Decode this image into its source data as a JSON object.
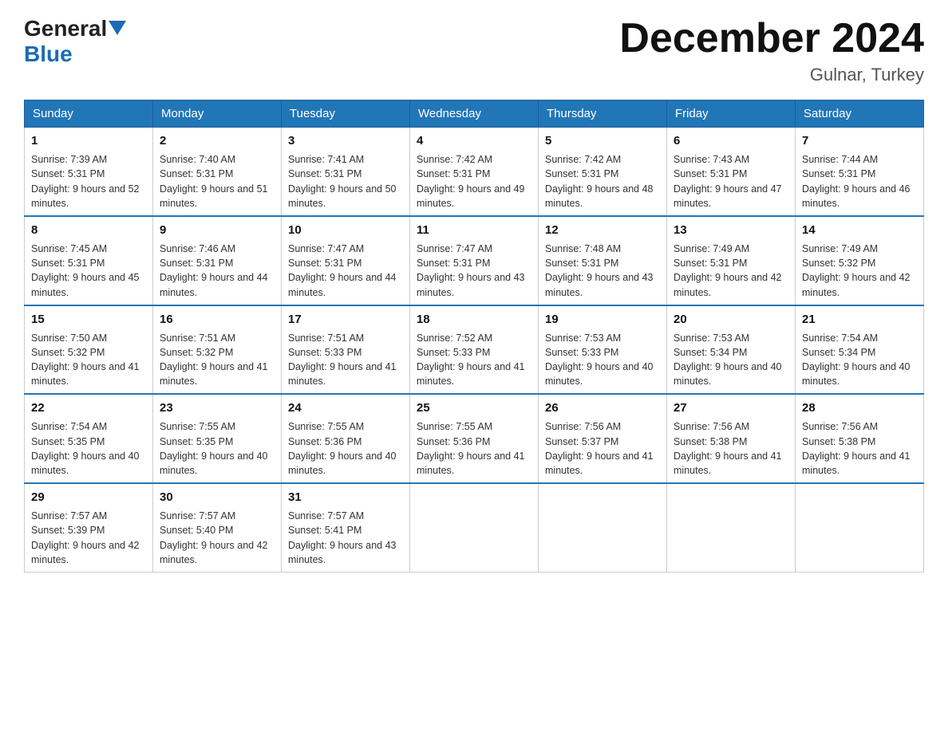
{
  "header": {
    "logo_general": "General",
    "logo_blue": "Blue",
    "month_title": "December 2024",
    "location": "Gulnar, Turkey"
  },
  "weekdays": [
    "Sunday",
    "Monday",
    "Tuesday",
    "Wednesday",
    "Thursday",
    "Friday",
    "Saturday"
  ],
  "weeks": [
    [
      {
        "day": "1",
        "sunrise": "Sunrise: 7:39 AM",
        "sunset": "Sunset: 5:31 PM",
        "daylight": "Daylight: 9 hours and 52 minutes."
      },
      {
        "day": "2",
        "sunrise": "Sunrise: 7:40 AM",
        "sunset": "Sunset: 5:31 PM",
        "daylight": "Daylight: 9 hours and 51 minutes."
      },
      {
        "day": "3",
        "sunrise": "Sunrise: 7:41 AM",
        "sunset": "Sunset: 5:31 PM",
        "daylight": "Daylight: 9 hours and 50 minutes."
      },
      {
        "day": "4",
        "sunrise": "Sunrise: 7:42 AM",
        "sunset": "Sunset: 5:31 PM",
        "daylight": "Daylight: 9 hours and 49 minutes."
      },
      {
        "day": "5",
        "sunrise": "Sunrise: 7:42 AM",
        "sunset": "Sunset: 5:31 PM",
        "daylight": "Daylight: 9 hours and 48 minutes."
      },
      {
        "day": "6",
        "sunrise": "Sunrise: 7:43 AM",
        "sunset": "Sunset: 5:31 PM",
        "daylight": "Daylight: 9 hours and 47 minutes."
      },
      {
        "day": "7",
        "sunrise": "Sunrise: 7:44 AM",
        "sunset": "Sunset: 5:31 PM",
        "daylight": "Daylight: 9 hours and 46 minutes."
      }
    ],
    [
      {
        "day": "8",
        "sunrise": "Sunrise: 7:45 AM",
        "sunset": "Sunset: 5:31 PM",
        "daylight": "Daylight: 9 hours and 45 minutes."
      },
      {
        "day": "9",
        "sunrise": "Sunrise: 7:46 AM",
        "sunset": "Sunset: 5:31 PM",
        "daylight": "Daylight: 9 hours and 44 minutes."
      },
      {
        "day": "10",
        "sunrise": "Sunrise: 7:47 AM",
        "sunset": "Sunset: 5:31 PM",
        "daylight": "Daylight: 9 hours and 44 minutes."
      },
      {
        "day": "11",
        "sunrise": "Sunrise: 7:47 AM",
        "sunset": "Sunset: 5:31 PM",
        "daylight": "Daylight: 9 hours and 43 minutes."
      },
      {
        "day": "12",
        "sunrise": "Sunrise: 7:48 AM",
        "sunset": "Sunset: 5:31 PM",
        "daylight": "Daylight: 9 hours and 43 minutes."
      },
      {
        "day": "13",
        "sunrise": "Sunrise: 7:49 AM",
        "sunset": "Sunset: 5:31 PM",
        "daylight": "Daylight: 9 hours and 42 minutes."
      },
      {
        "day": "14",
        "sunrise": "Sunrise: 7:49 AM",
        "sunset": "Sunset: 5:32 PM",
        "daylight": "Daylight: 9 hours and 42 minutes."
      }
    ],
    [
      {
        "day": "15",
        "sunrise": "Sunrise: 7:50 AM",
        "sunset": "Sunset: 5:32 PM",
        "daylight": "Daylight: 9 hours and 41 minutes."
      },
      {
        "day": "16",
        "sunrise": "Sunrise: 7:51 AM",
        "sunset": "Sunset: 5:32 PM",
        "daylight": "Daylight: 9 hours and 41 minutes."
      },
      {
        "day": "17",
        "sunrise": "Sunrise: 7:51 AM",
        "sunset": "Sunset: 5:33 PM",
        "daylight": "Daylight: 9 hours and 41 minutes."
      },
      {
        "day": "18",
        "sunrise": "Sunrise: 7:52 AM",
        "sunset": "Sunset: 5:33 PM",
        "daylight": "Daylight: 9 hours and 41 minutes."
      },
      {
        "day": "19",
        "sunrise": "Sunrise: 7:53 AM",
        "sunset": "Sunset: 5:33 PM",
        "daylight": "Daylight: 9 hours and 40 minutes."
      },
      {
        "day": "20",
        "sunrise": "Sunrise: 7:53 AM",
        "sunset": "Sunset: 5:34 PM",
        "daylight": "Daylight: 9 hours and 40 minutes."
      },
      {
        "day": "21",
        "sunrise": "Sunrise: 7:54 AM",
        "sunset": "Sunset: 5:34 PM",
        "daylight": "Daylight: 9 hours and 40 minutes."
      }
    ],
    [
      {
        "day": "22",
        "sunrise": "Sunrise: 7:54 AM",
        "sunset": "Sunset: 5:35 PM",
        "daylight": "Daylight: 9 hours and 40 minutes."
      },
      {
        "day": "23",
        "sunrise": "Sunrise: 7:55 AM",
        "sunset": "Sunset: 5:35 PM",
        "daylight": "Daylight: 9 hours and 40 minutes."
      },
      {
        "day": "24",
        "sunrise": "Sunrise: 7:55 AM",
        "sunset": "Sunset: 5:36 PM",
        "daylight": "Daylight: 9 hours and 40 minutes."
      },
      {
        "day": "25",
        "sunrise": "Sunrise: 7:55 AM",
        "sunset": "Sunset: 5:36 PM",
        "daylight": "Daylight: 9 hours and 41 minutes."
      },
      {
        "day": "26",
        "sunrise": "Sunrise: 7:56 AM",
        "sunset": "Sunset: 5:37 PM",
        "daylight": "Daylight: 9 hours and 41 minutes."
      },
      {
        "day": "27",
        "sunrise": "Sunrise: 7:56 AM",
        "sunset": "Sunset: 5:38 PM",
        "daylight": "Daylight: 9 hours and 41 minutes."
      },
      {
        "day": "28",
        "sunrise": "Sunrise: 7:56 AM",
        "sunset": "Sunset: 5:38 PM",
        "daylight": "Daylight: 9 hours and 41 minutes."
      }
    ],
    [
      {
        "day": "29",
        "sunrise": "Sunrise: 7:57 AM",
        "sunset": "Sunset: 5:39 PM",
        "daylight": "Daylight: 9 hours and 42 minutes."
      },
      {
        "day": "30",
        "sunrise": "Sunrise: 7:57 AM",
        "sunset": "Sunset: 5:40 PM",
        "daylight": "Daylight: 9 hours and 42 minutes."
      },
      {
        "day": "31",
        "sunrise": "Sunrise: 7:57 AM",
        "sunset": "Sunset: 5:41 PM",
        "daylight": "Daylight: 9 hours and 43 minutes."
      },
      null,
      null,
      null,
      null
    ]
  ]
}
